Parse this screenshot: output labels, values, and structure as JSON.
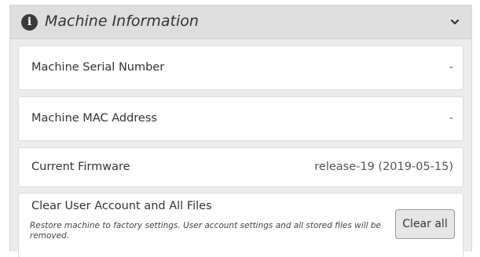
{
  "panel": {
    "title": "Machine Information",
    "info_icon_glyph": "i",
    "icon": "info-circle-icon",
    "toggle_icon": "chevron-down-icon"
  },
  "rows": [
    {
      "label": "Machine Serial Number",
      "value": "-"
    },
    {
      "label": "Machine MAC Address",
      "value": "-"
    },
    {
      "label": "Current Firmware",
      "value": "release-19 (2019-05-15)"
    }
  ],
  "clear_section": {
    "title": "Clear User Account and All Files",
    "description": "Restore machine to factory settings. User account settings and all stored files will be removed.",
    "button_label": "Clear all"
  }
}
